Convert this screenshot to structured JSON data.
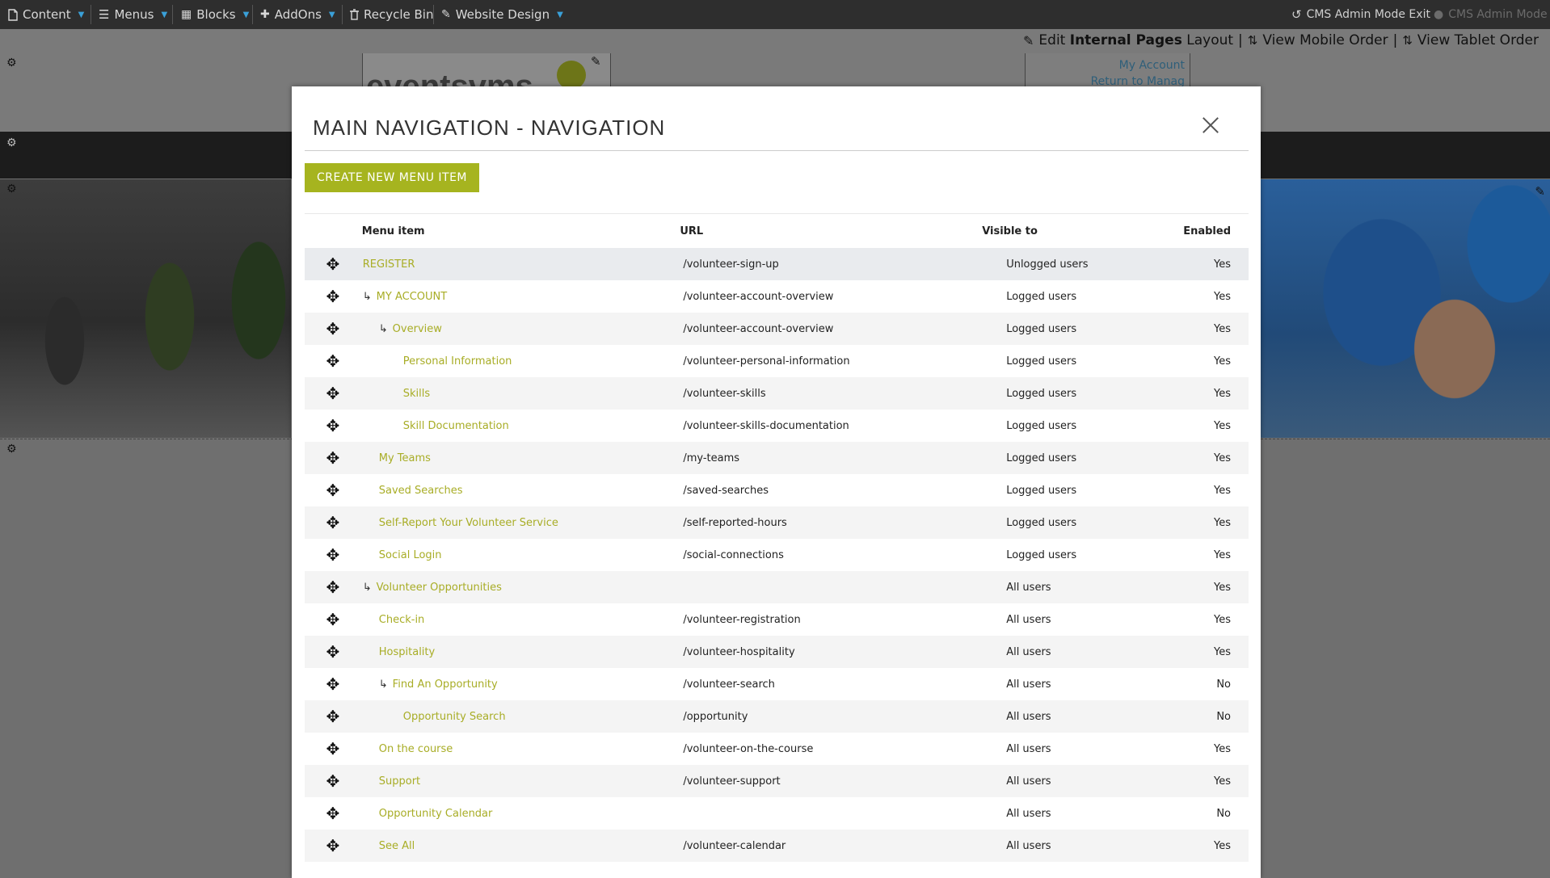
{
  "topbar": {
    "items": [
      {
        "label": "Content",
        "icon": "page-icon"
      },
      {
        "label": "Menus",
        "icon": "list-icon"
      },
      {
        "label": "Blocks",
        "icon": "grid-icon"
      },
      {
        "label": "AddOns",
        "icon": "puzzle-icon"
      },
      {
        "label": "Recycle Bin",
        "icon": "trash-icon"
      },
      {
        "label": "Website Design",
        "icon": "brush-icon"
      }
    ],
    "exit_label": "CMS Admin Mode Exit",
    "mode_label": "CMS Admin Mode"
  },
  "editbar": {
    "edit_prefix": "Edit",
    "edit_bold": "Internal Pages",
    "edit_suffix": "Layout",
    "mobile_label": "View Mobile Order",
    "tablet_label": "View Tablet Order"
  },
  "background": {
    "logo_text": "eventsvms",
    "my_account": "My Account",
    "return_link": "Return to Manag"
  },
  "modal": {
    "title": "MAIN NAVIGATION - NAVIGATION",
    "create_button": "CREATE NEW MENU ITEM",
    "columns": [
      "Menu item",
      "URL",
      "Visible to",
      "Enabled"
    ],
    "rows": [
      {
        "label": "REGISTER",
        "level": 0,
        "arrow": false,
        "url": "/volunteer-sign-up",
        "visible": "Unlogged users",
        "enabled": "Yes"
      },
      {
        "label": "MY ACCOUNT",
        "level": 1,
        "arrow": true,
        "url": "/volunteer-account-overview",
        "visible": "Logged users",
        "enabled": "Yes"
      },
      {
        "label": "Overview",
        "level": 2,
        "arrow": true,
        "url": "/volunteer-account-overview",
        "visible": "Logged users",
        "enabled": "Yes"
      },
      {
        "label": "Personal Information",
        "level": 3,
        "arrow": false,
        "url": "/volunteer-personal-information",
        "visible": "Logged users",
        "enabled": "Yes"
      },
      {
        "label": "Skills",
        "level": 3,
        "arrow": false,
        "url": "/volunteer-skills",
        "visible": "Logged users",
        "enabled": "Yes"
      },
      {
        "label": "Skill Documentation",
        "level": 3,
        "arrow": false,
        "url": "/volunteer-skills-documentation",
        "visible": "Logged users",
        "enabled": "Yes"
      },
      {
        "label": "My Teams",
        "level": 2,
        "arrow": false,
        "url": "/my-teams",
        "visible": "Logged users",
        "enabled": "Yes"
      },
      {
        "label": "Saved Searches",
        "level": 2,
        "arrow": false,
        "url": "/saved-searches",
        "visible": "Logged users",
        "enabled": "Yes"
      },
      {
        "label": "Self-Report Your Volunteer Service",
        "level": 2,
        "arrow": false,
        "url": "/self-reported-hours",
        "visible": "Logged users",
        "enabled": "Yes"
      },
      {
        "label": "Social Login",
        "level": 2,
        "arrow": false,
        "url": "/social-connections",
        "visible": "Logged users",
        "enabled": "Yes"
      },
      {
        "label": "Volunteer Opportunities",
        "level": 1,
        "arrow": true,
        "url": "",
        "visible": "All users",
        "enabled": "Yes"
      },
      {
        "label": "Check-in",
        "level": 2,
        "arrow": false,
        "url": "/volunteer-registration",
        "visible": "All users",
        "enabled": "Yes"
      },
      {
        "label": "Hospitality",
        "level": 2,
        "arrow": false,
        "url": "/volunteer-hospitality",
        "visible": "All users",
        "enabled": "Yes"
      },
      {
        "label": "Find An Opportunity",
        "level": 2,
        "arrow": true,
        "url": "/volunteer-search",
        "visible": "All users",
        "enabled": "No"
      },
      {
        "label": "Opportunity Search",
        "level": 3,
        "arrow": false,
        "url": "/opportunity",
        "visible": "All users",
        "enabled": "No"
      },
      {
        "label": "On the course",
        "level": 2,
        "arrow": false,
        "url": "/volunteer-on-the-course",
        "visible": "All users",
        "enabled": "Yes"
      },
      {
        "label": "Support",
        "level": 2,
        "arrow": false,
        "url": "/volunteer-support",
        "visible": "All users",
        "enabled": "Yes"
      },
      {
        "label": "Opportunity Calendar",
        "level": 2,
        "arrow": false,
        "url": "",
        "visible": "All users",
        "enabled": "No"
      },
      {
        "label": "See All",
        "level": 2,
        "arrow": false,
        "url": "/volunteer-calendar",
        "visible": "All users",
        "enabled": "Yes"
      }
    ]
  },
  "colors": {
    "accent": "#a6b41f",
    "link": "#a8ad26",
    "topbar": "#2e2e2e",
    "caret": "#3aa0d8"
  }
}
